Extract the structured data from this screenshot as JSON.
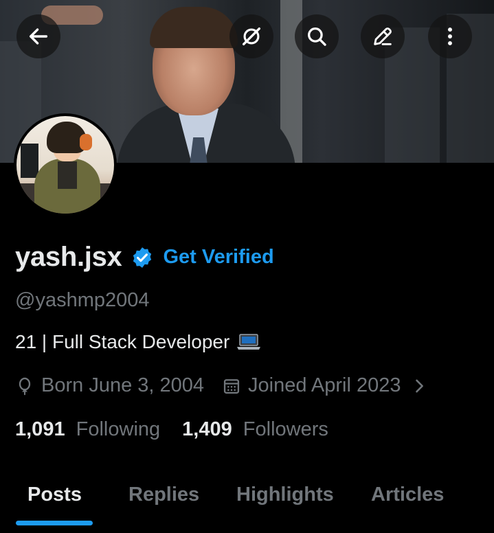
{
  "profile": {
    "name": "yash.jsx",
    "get_verified": "Get Verified",
    "handle": "@yashmp2004",
    "bio": "21 | Full Stack Developer",
    "born": "Born June 3, 2004",
    "joined": "Joined April 2023",
    "following_count": "1,091",
    "following_label": "Following",
    "followers_count": "1,409",
    "followers_label": "Followers"
  },
  "tabs": [
    {
      "label": "Posts",
      "active": true
    },
    {
      "label": "Replies"
    },
    {
      "label": "Highlights"
    },
    {
      "label": "Articles"
    }
  ],
  "icons": {
    "header": [
      "back-arrow-icon",
      "grok-icon",
      "search-icon",
      "edit-icon",
      "more-icon"
    ],
    "meta": [
      "birthday-balloon-icon",
      "calendar-icon",
      "chevron-right-icon"
    ],
    "bio_emoji": "laptop-icon",
    "verified": "verified-badge-icon"
  },
  "colors": {
    "accent": "#1d9bf0",
    "background": "#000000",
    "secondary_text": "#71767b",
    "primary_text": "#e7e9ea"
  }
}
